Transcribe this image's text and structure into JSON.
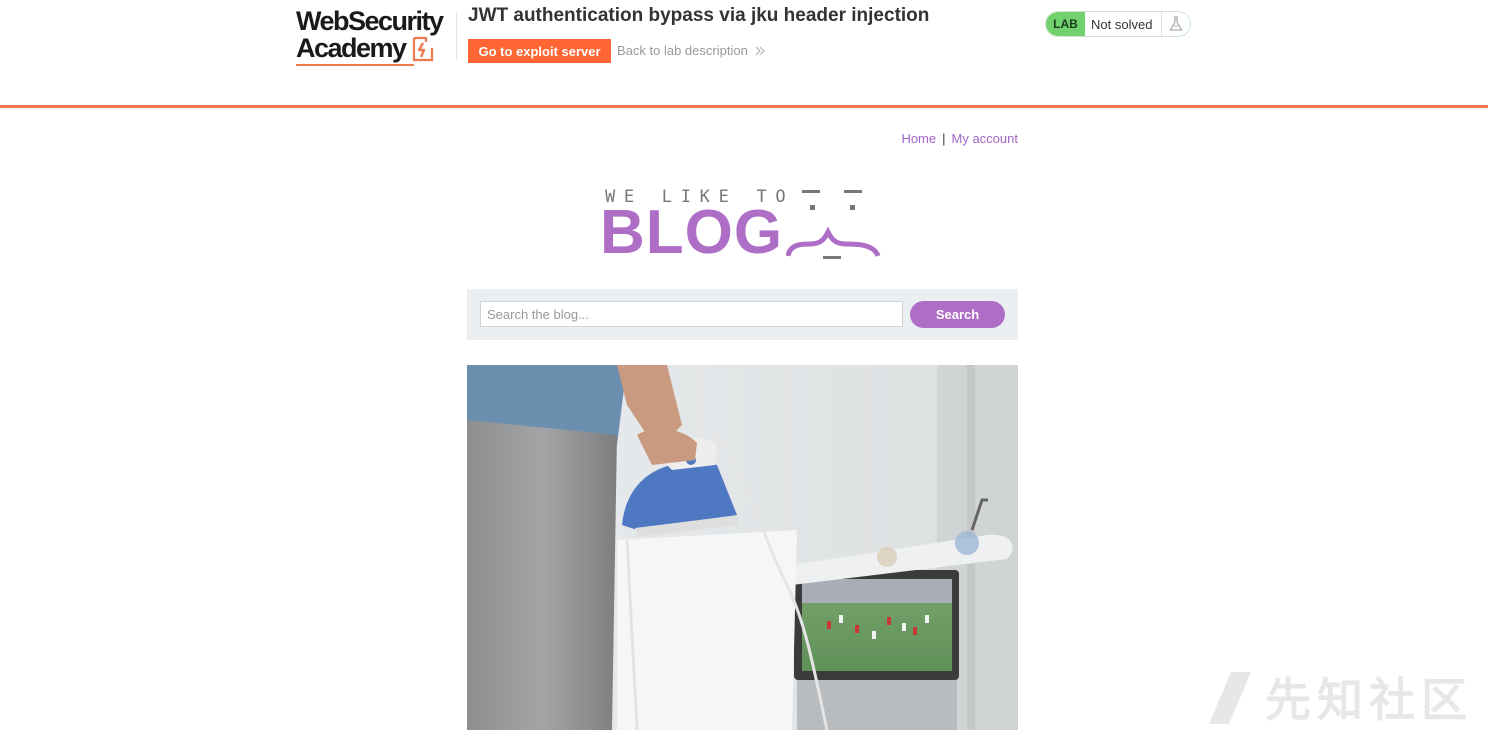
{
  "academy": {
    "logo_line1": "WebSecurity",
    "logo_line2": "Academy",
    "lab_title": "JWT authentication bypass via jku header injection",
    "exploit_button": "Go to exploit server",
    "back_link": "Back to lab description",
    "lab_badge": "LAB",
    "lab_status": "Not solved",
    "accent_color": "#ff6633",
    "status_color": "#70d16d"
  },
  "nav": {
    "home": "Home",
    "separator": "|",
    "my_account": "My account"
  },
  "banner": {
    "tagline": "WE LIKE TO",
    "title": "BLOG",
    "brand_color": "#ae6ec6"
  },
  "search": {
    "placeholder": "Search the blog...",
    "value": "",
    "button": "Search"
  },
  "post": {
    "image_icon": "photo-person-ironing-shirt-watching-football"
  },
  "watermark": {
    "text": "先知社区"
  }
}
